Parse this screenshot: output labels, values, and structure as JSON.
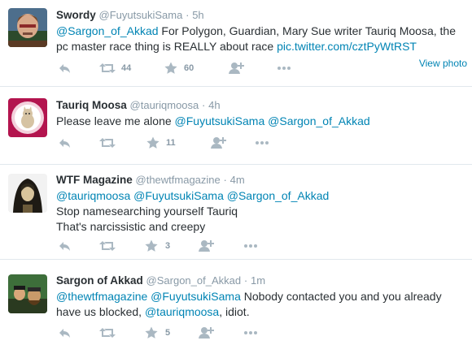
{
  "tweets": [
    {
      "name": "Swordy",
      "handle": "@FuyutsukiSama",
      "dot": "·",
      "time": "5h",
      "mention1": "@Sargon_of_Akkad",
      "text_a": " For Polygon, Guardian, Mary Sue writer Tauriq Moosa, the pc master race thing is REALLY about race ",
      "link": "pic.twitter.com/cztPyWtRST",
      "retweets": "44",
      "favorites": "60",
      "view_photo": "View photo"
    },
    {
      "name": "Tauriq Moosa",
      "handle": "@tauriqmoosa",
      "dot": "·",
      "time": "4h",
      "text_a": "Please leave me alone ",
      "mention1": "@FuyutsukiSama",
      "mention2": "@Sargon_of_Akkad",
      "favorites": "11"
    },
    {
      "name": "WTF Magazine",
      "handle": "@thewtfmagazine",
      "dot": "·",
      "time": "4m",
      "mention1": "@tauriqmoosa",
      "mention2": "@FuyutsukiSama",
      "mention3": "@Sargon_of_Akkad",
      "line2": "Stop namesearching yourself Tauriq",
      "line3": "That's narcissistic and creepy",
      "favorites": "3"
    },
    {
      "name": "Sargon of Akkad",
      "handle": "@Sargon_of_Akkad",
      "dot": "·",
      "time": "1m",
      "mention1": "@thewtfmagazine",
      "mention2": "@FuyutsukiSama",
      "text_a": " Nobody contacted you and you already have us blocked, ",
      "mention3": "@tauriqmoosa",
      "text_b": ", idiot.",
      "favorites": "5"
    }
  ],
  "colors": {
    "name": "#292f33",
    "meta": "#8899a6",
    "link": "#0084b4",
    "icon": "#aab8c2",
    "divider": "#e1e8ed"
  },
  "icons": [
    "reply-icon",
    "retweet-icon",
    "favorite-star-icon",
    "follow-icon",
    "more-icon"
  ]
}
